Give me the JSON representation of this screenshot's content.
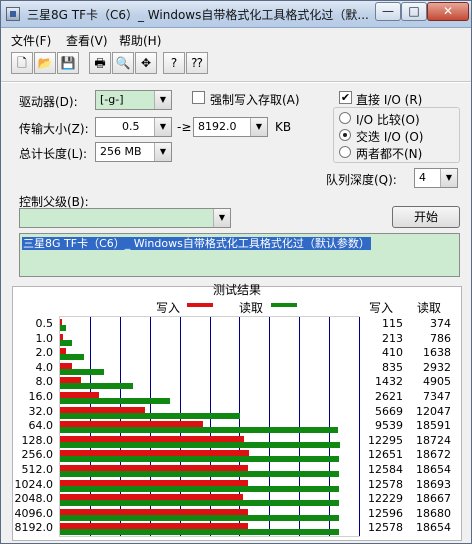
{
  "window": {
    "title": "三星8G TF卡（C6）_ Windows自带格式化工具格式化过（默...",
    "minimize": "—",
    "maximize": "□",
    "close": "✕"
  },
  "menu": [
    "文件(F)",
    "查看(V)",
    "帮助(H)"
  ],
  "toolbar": {
    "icons": [
      "new-icon",
      "open-icon",
      "save-icon",
      "print-icon",
      "print-preview-icon",
      "move-icon",
      "help-icon",
      "context-help-icon"
    ],
    "glyphs": [
      "🗋",
      "📂",
      "💾",
      "🖶",
      "🔍",
      "✥",
      "?",
      "⁇"
    ]
  },
  "settings": {
    "drive_label": "驱动器(D):",
    "drive_value": "[-g-]",
    "force_write_label": "强制写入存取(A)",
    "force_write_checked": false,
    "direct_io_label": "直接 I/O (R)",
    "direct_io_checked": true,
    "transfer_label": "传输大小(Z):",
    "transfer_min": "0.5",
    "transfer_sep": "-≥",
    "transfer_max": "8192.0",
    "transfer_unit": "KB",
    "total_label": "总计长度(L):",
    "total_value": "256 MB",
    "io_modes": [
      {
        "label": "I/O 比较(O)",
        "selected": false
      },
      {
        "label": "交迭 I/O (O)",
        "selected": true
      },
      {
        "label": "两者都不(N)",
        "selected": false
      }
    ],
    "queue_label": "队列深度(Q):",
    "queue_value": "4",
    "control_label": "控制父级(B):",
    "control_value": "",
    "start_button": "开始",
    "description": "三星8G TF卡（C6）_ Windows自带格式化工具格式化过（默认参数）"
  },
  "results": {
    "title": "测试结果",
    "legend_write": "写入",
    "legend_read": "读取",
    "col_write": "写入",
    "col_read": "读取",
    "colors": {
      "write": "#dd1111",
      "read": "#118811",
      "grid": "#00008b"
    }
  },
  "chart_data": {
    "type": "bar",
    "orientation": "horizontal",
    "categories": [
      "0.5",
      "1.0",
      "2.0",
      "4.0",
      "8.0",
      "16.0",
      "32.0",
      "64.0",
      "128.0",
      "256.0",
      "512.0",
      "1024.0",
      "2048.0",
      "4096.0",
      "8192.0"
    ],
    "series": [
      {
        "name": "写入",
        "values": [
          115,
          213,
          410,
          835,
          1432,
          2621,
          5669,
          9539,
          12295,
          12651,
          12584,
          12578,
          12229,
          12596,
          12578
        ]
      },
      {
        "name": "读取",
        "values": [
          374,
          786,
          1638,
          2932,
          4905,
          7347,
          12047,
          18591,
          18724,
          18672,
          18654,
          18693,
          18667,
          18680,
          18654
        ]
      }
    ],
    "xlim": [
      0,
      20000
    ],
    "grid": true,
    "legend": "top"
  }
}
